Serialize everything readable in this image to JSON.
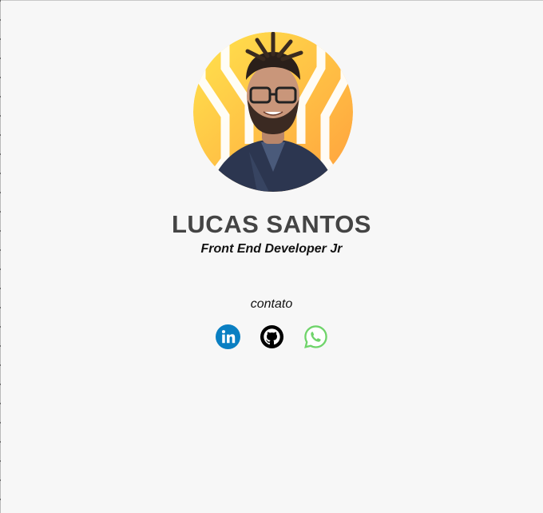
{
  "profile": {
    "name": "LUCAS SANTOS",
    "role": "Front End Developer Jr"
  },
  "contact": {
    "label": "contato",
    "links": [
      {
        "icon": "linkedin-icon",
        "color": "#0a7fc2"
      },
      {
        "icon": "github-icon",
        "color": "#000000"
      },
      {
        "icon": "whatsapp-icon",
        "color": "#6fd46a"
      }
    ]
  },
  "colors": {
    "background": "#f7f7f7",
    "name": "#444444",
    "avatar_gradient_start": "#ffd84a",
    "avatar_gradient_end": "#ffa63a"
  }
}
